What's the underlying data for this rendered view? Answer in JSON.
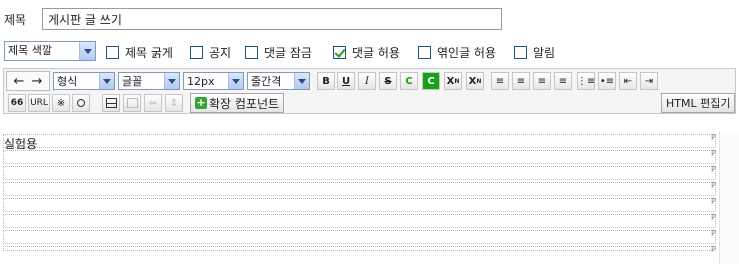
{
  "title": {
    "label": "제목",
    "value": "게시판 글 쓰기"
  },
  "options": {
    "color_select": "제목 색깔",
    "checkboxes": [
      {
        "label": "제목 굵게",
        "checked": false
      },
      {
        "label": "공지",
        "checked": false
      },
      {
        "label": "댓글 잠금",
        "checked": false
      },
      {
        "label": "댓글 허용",
        "checked": true
      },
      {
        "label": "엮인글 허용",
        "checked": false
      },
      {
        "label": "알림",
        "checked": false
      }
    ]
  },
  "toolbar": {
    "format_select": "형식",
    "font_select": "글꼴",
    "size_select": "12px",
    "linespacing_select": "줄간격",
    "bold": "B",
    "underline": "U",
    "italic": "I",
    "strike": "S",
    "text_color": "C",
    "bg_color": "C",
    "superscript": "X",
    "superscript_mark": "N",
    "subscript": "X",
    "subscript_mark": "N",
    "quote": "66",
    "url": "URL",
    "special_char": "※",
    "find": "Q",
    "extension_button": "확장 컴포넌트",
    "html_button": "HTML 편집기"
  },
  "editor": {
    "content": "실험용",
    "paragraph_marker": "P"
  }
}
